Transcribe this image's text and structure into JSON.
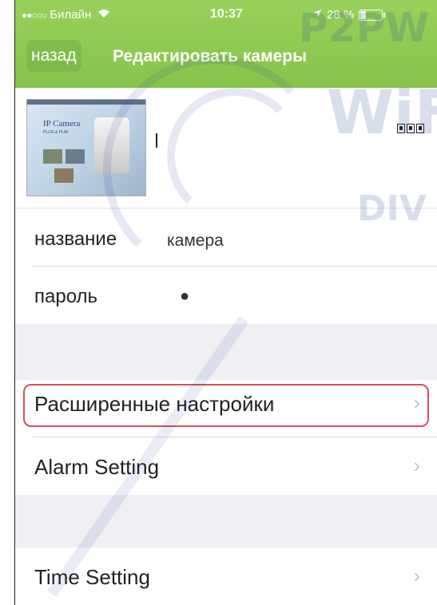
{
  "status_bar": {
    "signal": "●●○○○",
    "carrier": "Билайн",
    "wifi_icon": "wifi-icon",
    "time": "10:37",
    "location_icon": "location-arrow-icon",
    "battery_percent": "28 %",
    "battery_level": 0.28
  },
  "nav": {
    "back_label": "назад",
    "title": "Редактировать камеры"
  },
  "camera": {
    "thumbnail_caption": "IP Camera",
    "thumbnail_subcaption": "PLUG & PLAY",
    "qr_icon": "qr-code-icon"
  },
  "fields": {
    "name_label": "название",
    "name_value": "камера",
    "password_label": "пароль",
    "password_value": "●"
  },
  "menu": {
    "advanced_settings": "Расширенные настройки",
    "alarm_setting": "Alarm Setting",
    "time_setting": "Time Setting",
    "chevron": "›"
  },
  "watermark": {
    "brand_top": "P2PW",
    "brand_mid": "WiFi",
    "brand_low": "DIV"
  },
  "colors": {
    "header_green": "#8cc84f",
    "highlight_red": "#d6505a",
    "background_gray": "#efeff4"
  }
}
